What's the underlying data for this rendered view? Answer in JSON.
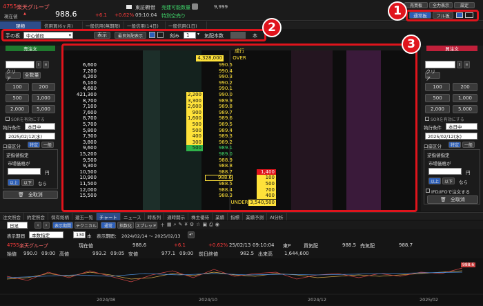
{
  "header": {
    "code": "4755",
    "name": "楽天グループ",
    "market_label": "東証P",
    "credit_label": "貸借",
    "sell_label": "売建可能数量",
    "sell_qty": "9,999",
    "special_label": "特別空売り",
    "special_value": "—",
    "now_label": "現在値",
    "price": "988.6",
    "change": "+6.1",
    "change_pct": "+0.62%",
    "time": "09:10:04"
  },
  "header_buttons": [
    "売買板",
    "全力表示",
    "設定"
  ],
  "board_mode": {
    "normal": "通常板",
    "full": "フル板"
  },
  "order_tabs": [
    "現物",
    "信用買(6ヶ月)",
    "一般信用(無期限)",
    "一般信用(14日)",
    "一般信用(1日)"
  ],
  "toolbar": {
    "fixed_label": "手の板",
    "center_value": "中心値段",
    "display_button": "表示",
    "highlight_label": "最良気配表示",
    "step_label": "刻み",
    "step_value": "1",
    "qty_label": "気配本数",
    "qty_unit": "本"
  },
  "left_panel": {
    "title": "売注文",
    "clear": "クリア",
    "all_qty": "全数量",
    "qty_buttons": [
      "100",
      "200",
      "500",
      "1,000",
      "2,000",
      "5,000"
    ],
    "sor_label": "SORを有効にする",
    "exec_label": "執行条件",
    "exec_value": "本日中",
    "date_value": "2025/02/12(水)",
    "account_label": "口座区分",
    "account_specific": "特定",
    "account_general": "一般",
    "reverse_label": "逆指値指定",
    "market_label": "市場価格が",
    "yen": "円",
    "above": "以上",
    "below": "以下",
    "then": "なら",
    "cancel_all": "全取消"
  },
  "right_panel": {
    "title": "買注文",
    "clear": "クリア",
    "qty_buttons": [
      "100",
      "200",
      "500",
      "1,000",
      "2,000",
      "5,000"
    ],
    "sor_label": "SORを有効にする",
    "exec_label": "執行条件",
    "exec_value": "本日中",
    "date_value": "2025/02/12(水)",
    "account_label": "口座区分",
    "account_specific": "特定",
    "account_general": "一般",
    "reverse_label": "逆指値指定",
    "market_label": "市場価格が",
    "yen": "円",
    "above": "以上",
    "below": "以下",
    "then": "なら",
    "ifd_label": "IFD/IFOで注文する",
    "cancel_all": "全取消"
  },
  "board": {
    "market_order": "成行",
    "over_label": "OVER",
    "over_qty": "4,328,000",
    "under_label": "UNDER",
    "under_qty": "3,540,500",
    "rows": [
      {
        "sell_qty": "6,600",
        "price": "990.5",
        "buy_qty": "",
        "own_sell": "",
        "cur": false
      },
      {
        "sell_qty": "7,200",
        "price": "990.4",
        "buy_qty": "",
        "own_sell": "",
        "cur": false
      },
      {
        "sell_qty": "4,200",
        "price": "990.3",
        "buy_qty": "",
        "own_sell": "",
        "cur": false
      },
      {
        "sell_qty": "6,100",
        "price": "990.2",
        "buy_qty": "",
        "own_sell": "",
        "cur": false
      },
      {
        "sell_qty": "4,600",
        "price": "990.1",
        "buy_qty": "",
        "own_sell": "",
        "cur": false
      },
      {
        "sell_qty": "421,300",
        "price": "990.0",
        "buy_qty": "",
        "own_sell": "2,200",
        "cur": false
      },
      {
        "sell_qty": "8,700",
        "price": "989.9",
        "buy_qty": "",
        "own_sell": "3,300",
        "cur": false
      },
      {
        "sell_qty": "7,100",
        "price": "989.8",
        "buy_qty": "",
        "own_sell": "2,600",
        "cur": false
      },
      {
        "sell_qty": "7,600",
        "price": "989.7",
        "buy_qty": "",
        "own_sell": "900",
        "cur": false
      },
      {
        "sell_qty": "8,700",
        "price": "989.6",
        "buy_qty": "",
        "own_sell": "1,600",
        "cur": false
      },
      {
        "sell_qty": "5,700",
        "price": "989.5",
        "buy_qty": "",
        "own_sell": "500",
        "cur": false
      },
      {
        "sell_qty": "5,800",
        "price": "989.4",
        "buy_qty": "",
        "own_sell": "500",
        "cur": false
      },
      {
        "sell_qty": "7,300",
        "price": "989.3",
        "buy_qty": "",
        "own_sell": "400",
        "cur": false
      },
      {
        "sell_qty": "3,800",
        "price": "989.2",
        "buy_qty": "",
        "own_sell": "300",
        "cur": false
      },
      {
        "sell_qty": "9,600",
        "price": "989.1",
        "buy_qty": "",
        "own_sell": "500",
        "cur": false
      },
      {
        "sell_qty": "15,200",
        "price": "989.0",
        "buy_qty": "",
        "own_sell": "",
        "cur": false
      },
      {
        "sell_qty": "9,500",
        "price": "988.9",
        "buy_qty": "",
        "own_sell": "",
        "cur": false
      },
      {
        "sell_qty": "9,300",
        "price": "988.8",
        "buy_qty": "",
        "own_sell": "",
        "cur": false
      },
      {
        "sell_qty": "10,500",
        "price": "988.7",
        "buy_qty": "1,400",
        "own_sell": "",
        "cur": false
      },
      {
        "sell_qty": "10,900",
        "price": "988.6",
        "buy_qty": "100",
        "own_sell": "",
        "cur": true
      },
      {
        "sell_qty": "11,500",
        "price": "988.5",
        "buy_qty": "500",
        "own_sell": "",
        "cur": false
      },
      {
        "sell_qty": "12,000",
        "price": "988.4",
        "buy_qty": "700",
        "own_sell": "",
        "cur": false
      },
      {
        "sell_qty": "15,500",
        "price": "988.3",
        "buy_qty": "400",
        "own_sell": "",
        "cur": false
      }
    ]
  },
  "bottom_tabs": [
    "注文照会",
    "約定照会",
    "保有銘柄",
    "建玉一覧",
    "チャート",
    "ニュース",
    "時系列",
    "適時開示",
    "株主優待",
    "業績",
    "指標",
    "業績予測",
    "AI分析"
  ],
  "chart_toolbar": {
    "period": "日足",
    "chart_label": "表示期間",
    "technical": "テクニカル",
    "normal": "通常",
    "index": "指数化",
    "spread": "スプレッド"
  },
  "chart_period": {
    "label": "表示期間",
    "range_value": "本数指定",
    "count": "130",
    "unit": "本",
    "period_label": "表示期間：",
    "period_value": "2024/02/14 〜 2025/02/13"
  },
  "chart_info": {
    "code": "4755",
    "name": "楽天グループ",
    "now_label": "現在値",
    "now": "988.6",
    "change": "+6.1",
    "change_pct": "+0.62%",
    "date": "25/02/13",
    "time": "09:10:04",
    "mkt": "東P",
    "bid_label": "買気配",
    "bid": "988.5",
    "ask_label": "売気配",
    "ask": "988.7",
    "open_label": "始値",
    "open": "990.0",
    "open_time": "09:00",
    "high_label": "高値",
    "high": "993.2",
    "high_time": "09:05",
    "low_label": "安値",
    "low": "977.1",
    "low_time": "09:00",
    "prev_label": "前日終値",
    "prev": "982.5",
    "vol_label": "出来高",
    "vol": "1,644,600"
  },
  "chart_axis": {
    "price_tag": "988.6",
    "dates": [
      "2024/08",
      "2024/10",
      "2024/12",
      "2025/02"
    ]
  },
  "callouts": [
    "1",
    "2",
    "3"
  ],
  "colors": {
    "accent": "#e0141c",
    "sell_green": "#1f7a2e",
    "buy_red": "#c0203a",
    "own_yellow": "#ffe23a"
  }
}
